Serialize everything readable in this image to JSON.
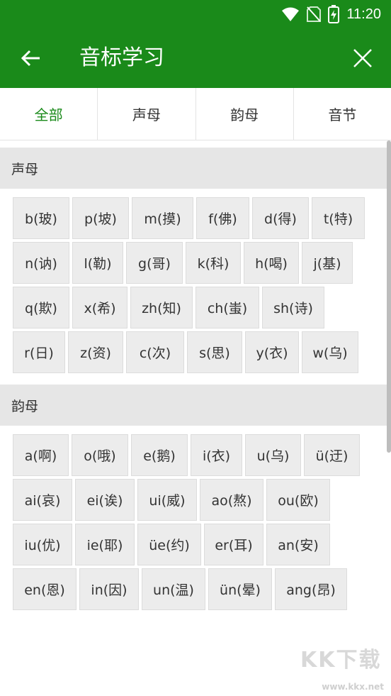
{
  "status_bar": {
    "time": "11:20",
    "icons": [
      "wifi-icon",
      "no-sim-icon",
      "battery-charging-icon"
    ]
  },
  "app_bar": {
    "title": "音标学习",
    "back_icon": "arrow-left-icon",
    "close_icon": "close-icon",
    "background": "#1a8a1a"
  },
  "tabs": [
    {
      "label": "全部",
      "active": true
    },
    {
      "label": "声母",
      "active": false
    },
    {
      "label": "韵母",
      "active": false
    },
    {
      "label": "音节",
      "active": false
    }
  ],
  "accent_color": "#1a8a1a",
  "sections": [
    {
      "title": "声母",
      "items": [
        "b(玻)",
        "p(坡)",
        "m(摸)",
        "f(佛)",
        "d(得)",
        "t(特)",
        "n(讷)",
        "l(勒)",
        "g(哥)",
        "k(科)",
        "h(喝)",
        "j(基)",
        "q(欺)",
        "x(希)",
        "zh(知)",
        "ch(蚩)",
        "sh(诗)",
        "r(日)",
        "z(资)",
        "c(次)",
        "s(思)",
        "y(衣)",
        "w(乌)"
      ]
    },
    {
      "title": "韵母",
      "items": [
        "a(啊)",
        "o(哦)",
        "e(鹅)",
        "i(衣)",
        "u(乌)",
        "ü(迂)",
        "ai(哀)",
        "ei(诶)",
        "ui(威)",
        "ao(熬)",
        "ou(欧)",
        "iu(优)",
        "ie(耶)",
        "üe(约)",
        "er(耳)",
        "an(安)",
        "en(恩)",
        "in(因)",
        "un(温)",
        "ün(晕)",
        "ang(昂)"
      ]
    }
  ],
  "watermark": {
    "text": "KK下载",
    "url": "www.kkx.net"
  }
}
